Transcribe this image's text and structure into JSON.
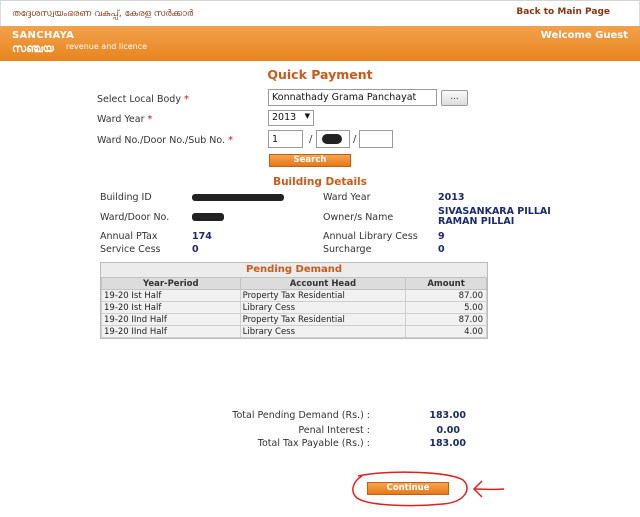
{
  "top": {
    "department_mal": "തദ്ദേശസ്വയംഭരണ വകുപ്പ്, കേരള സർക്കാർ",
    "back_link": "Back to Main Page"
  },
  "header": {
    "brand_en": "SANCHAYA",
    "brand_mal": "സഞ്ചയ",
    "tagline": "revenue and licence",
    "welcome": "Welcome Guest"
  },
  "form": {
    "title": "Quick Payment",
    "local_body_label": "Select Local Body",
    "local_body_value": "Konnathady Grama Panchayat",
    "browse_label": "...",
    "ward_year_label": "Ward Year",
    "ward_year_value": "2013",
    "ward_door_label": "Ward No./Door No./Sub No.",
    "ward_no_value": "1",
    "door_no_value": "",
    "sub_no_value": "",
    "required_mark": "*",
    "search_button": "Search"
  },
  "building": {
    "title": "Building Details",
    "building_id_label": "Building ID",
    "ward_year_label": "Ward Year",
    "ward_year_value": "2013",
    "ward_door_label": "Ward/Door No.",
    "owner_label": "Owner/s Name",
    "owner_line1": "SIVASANKARA PILLAI",
    "owner_line2": "RAMAN PILLAI",
    "annual_ptax_label": "Annual PTax",
    "annual_ptax_value": "174",
    "library_cess_label": "Annual Library Cess",
    "library_cess_value": "9",
    "service_cess_label": "Service Cess",
    "service_cess_value": "0",
    "surcharge_label": "Surcharge",
    "surcharge_value": "0"
  },
  "pending": {
    "title": "Pending Demand",
    "columns": [
      "Year-Period",
      "Account Head",
      "Amount"
    ],
    "rows": [
      [
        "19-20 Ist Half",
        "Property Tax Residential",
        "87.00"
      ],
      [
        "19-20 Ist Half",
        "Library Cess",
        "5.00"
      ],
      [
        "19-20 IInd Half",
        "Property Tax Residential",
        "87.00"
      ],
      [
        "19-20 IInd Half",
        "Library Cess",
        "4.00"
      ]
    ]
  },
  "summary": {
    "total_pending_label": "Total Pending Demand (Rs.) :",
    "total_pending_value": "183.00",
    "penal_label": "Penal Interest :",
    "penal_value": "0.00",
    "total_payable_label": "Total Tax Payable (Rs.) :",
    "total_payable_value": "183.00"
  },
  "actions": {
    "continue_button": "Continue"
  },
  "colors": {
    "accent": "#e8841f",
    "heading": "#cc5a1a",
    "value_text": "#1a2a6c",
    "annotation": "#e02020"
  }
}
